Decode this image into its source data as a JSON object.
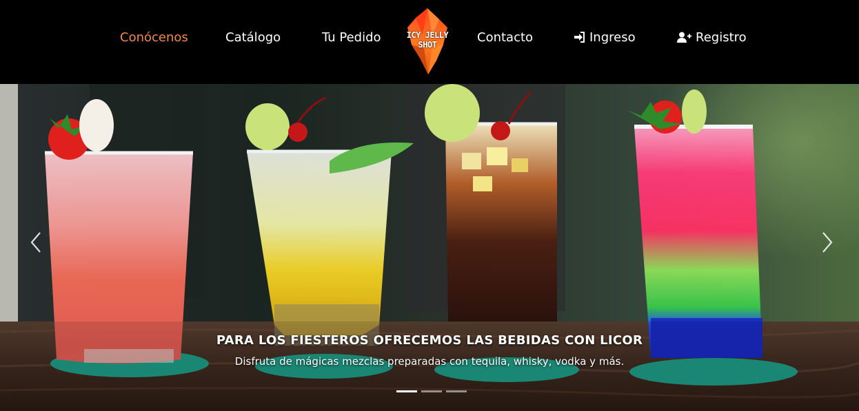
{
  "nav": {
    "items": [
      {
        "label": "Conócenos",
        "active": true
      },
      {
        "label": "Catálogo"
      },
      {
        "label": "Tu Pedido"
      },
      {
        "label": "Contacto"
      },
      {
        "label": "Ingreso",
        "icon": "sign-in-icon"
      },
      {
        "label": "Registro",
        "icon": "user-plus-icon"
      }
    ],
    "logo_text": "ICY JELLY SHOT",
    "active_color": "#f0894a"
  },
  "carousel": {
    "caption_title": "PARA LOS FIESTEROS OFRECEMOS LAS BEBIDAS CON LICOR",
    "caption_text": "Disfruta de mágicas mezclas preparadas con tequila, whisky, vodka y más.",
    "slide_count": 3,
    "active_slide": 1,
    "prev_icon": "chevron-left-icon",
    "next_icon": "chevron-right-icon"
  }
}
